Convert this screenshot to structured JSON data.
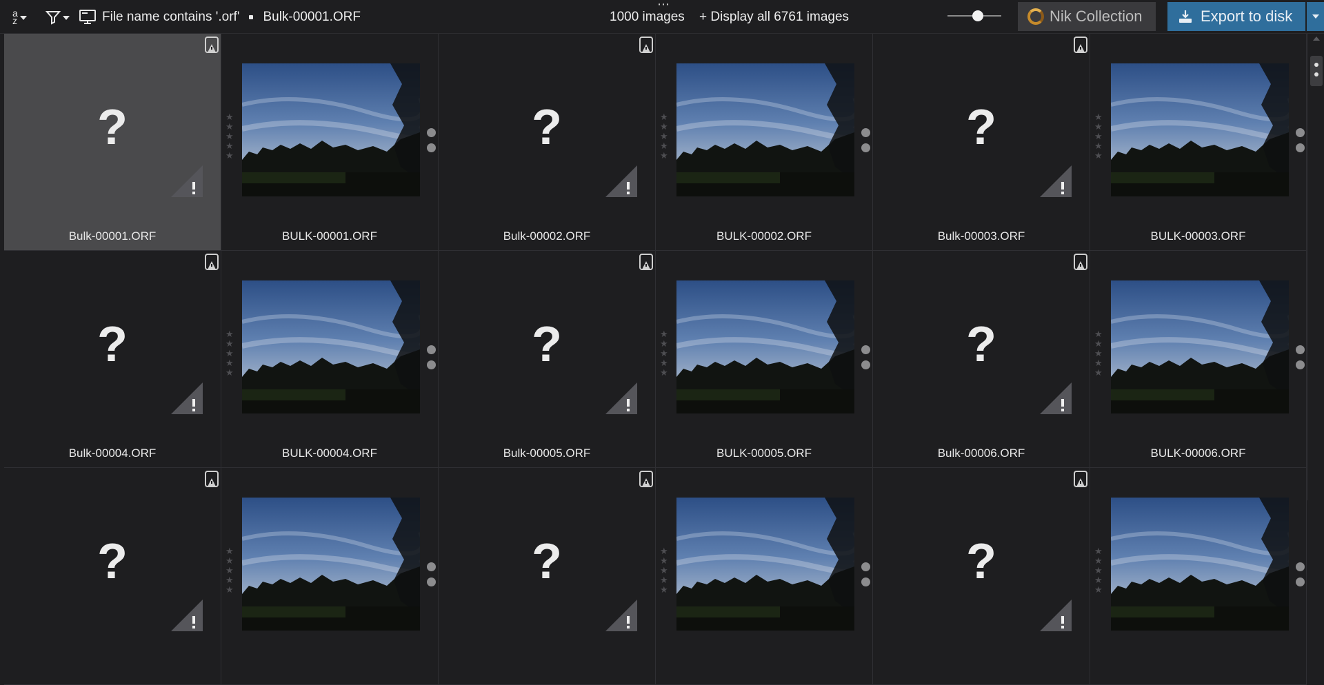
{
  "toolbar": {
    "sort_icon": "sort-az-icon",
    "filter_icon": "filter-icon",
    "filter_text": "File name contains '.orf'",
    "current_file": "Bulk-00001.ORF",
    "image_count": "1000 images",
    "display_all": "+ Display all 6761 images",
    "nik_label": "Nik Collection",
    "export_label": "Export to disk",
    "accent_color": "#2f6e9c"
  },
  "grid": {
    "rows": [
      [
        {
          "name": "Bulk-00001.ORF",
          "kind": "placeholder",
          "selected": true
        },
        {
          "name": "BULK-00001.ORF",
          "kind": "photo"
        },
        {
          "name": "Bulk-00002.ORF",
          "kind": "placeholder"
        },
        {
          "name": "BULK-00002.ORF",
          "kind": "photo"
        },
        {
          "name": "Bulk-00003.ORF",
          "kind": "placeholder"
        },
        {
          "name": "BULK-00003.ORF",
          "kind": "photo"
        }
      ],
      [
        {
          "name": "Bulk-00004.ORF",
          "kind": "placeholder"
        },
        {
          "name": "BULK-00004.ORF",
          "kind": "photo"
        },
        {
          "name": "Bulk-00005.ORF",
          "kind": "placeholder"
        },
        {
          "name": "BULK-00005.ORF",
          "kind": "photo"
        },
        {
          "name": "Bulk-00006.ORF",
          "kind": "placeholder"
        },
        {
          "name": "BULK-00006.ORF",
          "kind": "photo"
        }
      ],
      [
        {
          "name": "",
          "kind": "placeholder"
        },
        {
          "name": "",
          "kind": "photo"
        },
        {
          "name": "",
          "kind": "placeholder"
        },
        {
          "name": "",
          "kind": "photo"
        },
        {
          "name": "",
          "kind": "placeholder"
        },
        {
          "name": "",
          "kind": "photo"
        }
      ]
    ],
    "placeholder_symbol": "?"
  }
}
